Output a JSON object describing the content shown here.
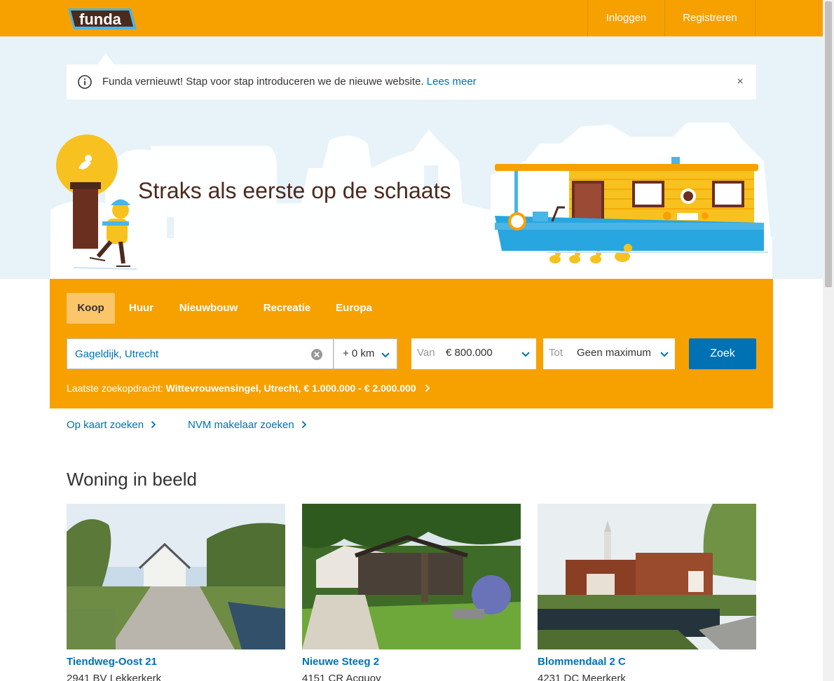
{
  "header": {
    "logo_text": "funda",
    "login": "Inloggen",
    "register": "Registreren",
    "brand_color": "#f7a100"
  },
  "notice": {
    "text": "Funda vernieuwt! Stap voor stap introduceren we de nieuwe website.",
    "link": "Lees meer",
    "close": "×"
  },
  "hero": {
    "title": "Straks als eerste op de schaats"
  },
  "search": {
    "tabs": [
      {
        "label": "Koop",
        "active": true
      },
      {
        "label": "Huur",
        "active": false
      },
      {
        "label": "Nieuwbouw",
        "active": false
      },
      {
        "label": "Recreatie",
        "active": false
      },
      {
        "label": "Europa",
        "active": false
      }
    ],
    "location_value": "Gageldijk, Utrecht",
    "radius": "+ 0 km",
    "price_from_label": "Van",
    "price_from_value": "€ 800.000",
    "price_to_label": "Tot",
    "price_to_value": "Geen maximum",
    "submit": "Zoek",
    "last_search_label": "Laatste zoekopdracht:",
    "last_search_value": "Wittevrouwensingel, Utrecht, € 1.000.000 - € 2.000.000"
  },
  "quick_links": {
    "map": "Op kaart zoeken",
    "nvm": "NVM makelaar zoeken"
  },
  "featured": {
    "title": "Woning in beeld",
    "cards": [
      {
        "title": "Tiendweg-Oost 21",
        "subtitle": "2941 BV Lekkerkerk"
      },
      {
        "title": "Nieuwe Steeg 2",
        "subtitle": "4151 CR Acquoy"
      },
      {
        "title": "Blommendaal 2 C",
        "subtitle": "4231 DC Meerkerk"
      }
    ]
  },
  "colors": {
    "link": "#0071b3",
    "search_panel": "#f7a100",
    "hero_bg": "#e8f2f9"
  }
}
